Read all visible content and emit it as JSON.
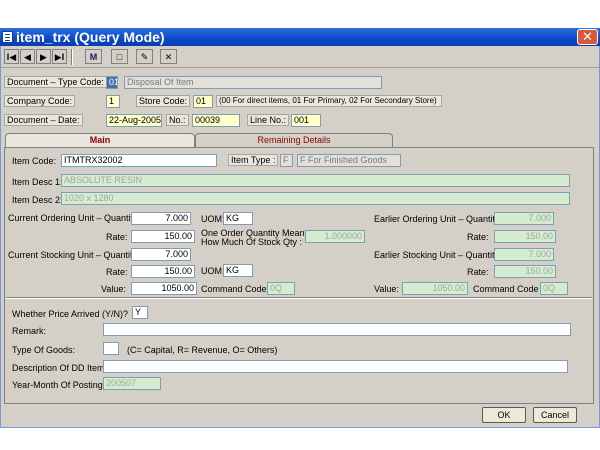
{
  "window": {
    "title": "item_trx (Query Mode)",
    "close": "✕"
  },
  "toolbar": {
    "first": "I◀",
    "prev": "◀",
    "next": "▶",
    "last": "▶I",
    "find": "M",
    "new": "□",
    "edit": "✎",
    "delete": "✕"
  },
  "header": {
    "doc_type_label": "Document – Type Code:",
    "doc_type_code": "01",
    "doc_type_desc": "Disposal Of Item",
    "company_label": "Company Code:",
    "company_code": "1",
    "store_label": "Store Code:",
    "store_code": "01",
    "store_note": "(00 For direct items, 01 For Primary, 02 For Secondary Store)",
    "doc_date_label": "Document – Date:",
    "doc_date": "22-Aug-2005",
    "no_label": "No.:",
    "no_value": "00039",
    "line_label": "Line No.:",
    "line_value": "001"
  },
  "tabs": {
    "main": "Main",
    "remaining": "Remaining Details"
  },
  "main": {
    "item_code_label": "Item Code:",
    "item_code": "ITMTRX32002",
    "item_type_label": "Item Type :",
    "item_type": "F",
    "item_type_desc": "F For Finished Goods",
    "desc1_label": "Item Desc 1:",
    "desc1": "ABSOLUTE RESIN",
    "desc2_label": "Item Desc 2:",
    "desc2": "1020 x 1280",
    "cur_order_qty_label": "Current Ordering Unit – Quantity:",
    "cur_order_qty": "7.000",
    "uom1_label": "UOM:",
    "uom1": "KG",
    "earlier_order_qty_label": "Earlier Ordering Unit – Quantity:",
    "earlier_order_qty": "7.000",
    "rate1_label": "Rate:",
    "rate1": "150.00",
    "one_order_label1": "One Order Quantity Means",
    "one_order_label2": "How Much Of Stock Qty :",
    "one_order_value": "1.000000",
    "earlier_rate1_label": "Rate:",
    "earlier_rate1": "150.00",
    "cur_stock_qty_label": "Current Stocking Unit – Quantity:",
    "cur_stock_qty": "7.000",
    "earlier_stock_qty_label": "Earlier Stocking Unit – Quantity:",
    "earlier_stock_qty": "7.000",
    "rate2_label": "Rate:",
    "rate2": "150.00",
    "uom2_label": "UOM:",
    "uom2": "KG",
    "earlier_rate2_label": "Rate:",
    "earlier_rate2": "150.00",
    "value_label": "Value:",
    "value": "1050.00",
    "command_label": "Command Code :",
    "command": "0Q",
    "earlier_value_label": "Value:",
    "earlier_value": "1050.00",
    "earlier_command_label": "Command Code :",
    "earlier_command": "0Q",
    "price_arrived_label": "Whether Price Arrived (Y/N)?",
    "price_arrived": "Y",
    "remark_label": "Remark:",
    "remark": "",
    "goods_type_label": "Type Of Goods:",
    "goods_type": "",
    "goods_note": "(C= Capital, R= Revenue, O= Others)",
    "dd_item_label": "Description Of DD Item:",
    "dd_item": "",
    "posting_label": "Year-Month Of Posting:",
    "posting": "200507"
  },
  "buttons": {
    "ok": "OK",
    "cancel": "Cancel"
  }
}
